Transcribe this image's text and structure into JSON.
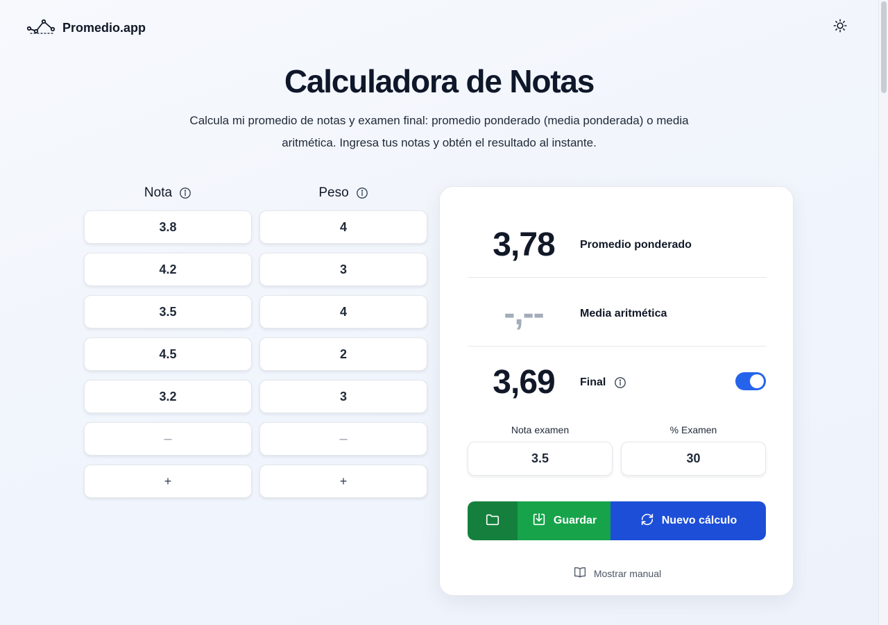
{
  "brand": {
    "name": "Promedio.app"
  },
  "title": "Calculadora de Notas",
  "subtitle": "Calcula mi promedio de notas y examen final: promedio ponderado (media ponderada) o media aritmética. Ingresa tus notas y obtén el resultado al instante.",
  "grades": {
    "nota_header": "Nota",
    "peso_header": "Peso",
    "rows": [
      {
        "nota": "3.8",
        "peso": "4"
      },
      {
        "nota": "4.2",
        "peso": "3"
      },
      {
        "nota": "3.5",
        "peso": "4"
      },
      {
        "nota": "4.5",
        "peso": "2"
      },
      {
        "nota": "3.2",
        "peso": "3"
      }
    ],
    "empty_placeholder": "–",
    "add_label": "+"
  },
  "results": {
    "weighted_value": "3,78",
    "weighted_label": "Promedio ponderado",
    "arithmetic_value": "-,--",
    "arithmetic_label": "Media aritmética",
    "final_value": "3,69",
    "final_label": "Final",
    "final_enabled": true
  },
  "exam": {
    "grade_label": "Nota examen",
    "grade_value": "3.5",
    "percent_label": "% Examen",
    "percent_value": "30"
  },
  "actions": {
    "save_label": "Guardar",
    "new_label": "Nuevo cálculo",
    "manual_label": "Mostrar manual"
  },
  "icons": {
    "logo": "line-chart-logo-icon",
    "theme": "sun-icon",
    "info": "info-icon",
    "folder": "folder-icon",
    "save": "download-icon",
    "new": "refresh-icon",
    "manual": "book-icon"
  },
  "colors": {
    "toggle_on": "#2563eb",
    "folder_btn": "#15803d",
    "save_btn": "#16a34a",
    "new_btn": "#1d4ed8"
  }
}
